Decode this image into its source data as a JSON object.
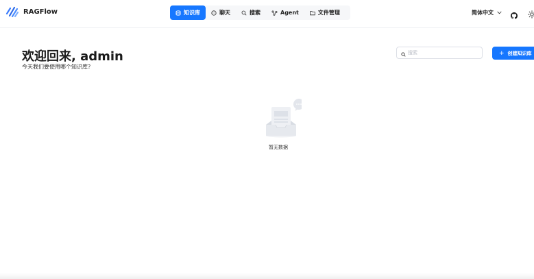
{
  "header": {
    "brand": "RAGFlow",
    "nav": [
      {
        "label": "知识库",
        "icon": "database-icon",
        "active": true
      },
      {
        "label": "聊天",
        "icon": "chat-icon",
        "active": false
      },
      {
        "label": "搜索",
        "icon": "search-icon",
        "active": false
      },
      {
        "label": "Agent",
        "icon": "agent-icon",
        "active": false
      },
      {
        "label": "文件管理",
        "icon": "folder-icon",
        "active": false
      }
    ],
    "language": "简体中文",
    "accent_color": "#1677ff"
  },
  "main": {
    "welcome": "欢迎回来, admin",
    "subtitle": "今天我们要使用哪个知识库?",
    "search_placeholder": "搜索",
    "create_button": "创建知识库",
    "empty_text": "暂无数据"
  }
}
